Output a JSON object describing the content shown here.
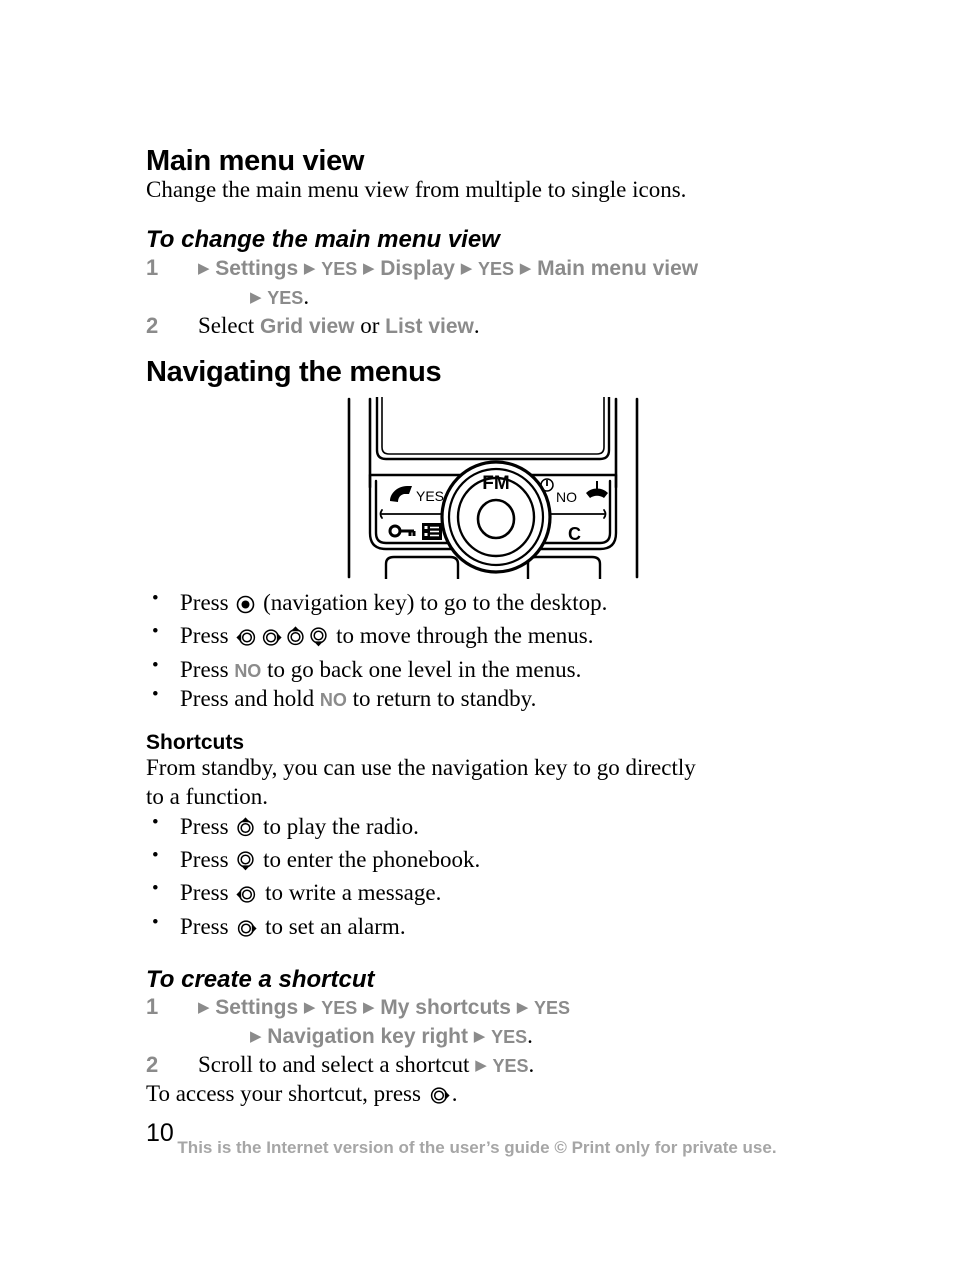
{
  "document": {
    "page_number": "10",
    "footer": "This is the Internet version of the user’s guide © Print only for private use."
  },
  "sections": {
    "main_menu_view": {
      "heading": "Main menu view",
      "intro": "Change the main menu view from multiple to single icons.",
      "procedure": {
        "heading": "To change the main menu view",
        "steps": [
          {
            "number": "1",
            "line1_parts": [
              "Settings",
              "YES",
              "Display",
              "YES",
              "Main menu view"
            ],
            "line2_part": "YES",
            "line2_suffix": "."
          },
          {
            "number": "2",
            "prefix": "Select ",
            "option_a": "Grid view",
            "conjunction": " or ",
            "option_b": "List view",
            "suffix": "."
          }
        ]
      }
    },
    "navigating": {
      "heading": "Navigating the menus",
      "figure_caption": "phone keypad and navigation key illustration",
      "bullets": [
        {
          "prefix": "Press ",
          "icon": "nav-key-center-icon",
          "suffix": " (navigation key) to go to the desktop."
        },
        {
          "prefix": "Press ",
          "icons": [
            "nav-key-left-icon",
            "nav-key-right-icon",
            "nav-key-up-icon",
            "nav-key-down-icon"
          ],
          "suffix": " to move through the menus."
        },
        {
          "prefix": "Press ",
          "ui_key": "NO",
          "suffix": " to go back one level in the menus."
        },
        {
          "prefix": "Press and hold ",
          "ui_key": "NO",
          "suffix": " to return to standby."
        }
      ]
    },
    "shortcuts": {
      "heading": "Shortcuts",
      "intro_line1": "From standby, you can use the navigation key to go directly",
      "intro_line2": "to a function.",
      "bullets": [
        {
          "prefix": "Press ",
          "icon": "nav-key-up-icon",
          "suffix": " to play the radio."
        },
        {
          "prefix": "Press ",
          "icon": "nav-key-down-icon",
          "suffix": " to enter the phonebook."
        },
        {
          "prefix": "Press ",
          "icon": "nav-key-left-icon",
          "suffix": " to write a message."
        },
        {
          "prefix": "Press ",
          "icon": "nav-key-right-icon",
          "suffix": " to set an alarm."
        }
      ],
      "procedure": {
        "heading": "To create a shortcut",
        "steps": [
          {
            "number": "1",
            "line1_parts": [
              "Settings",
              "YES",
              "My shortcuts",
              "YES"
            ],
            "line2_parts": [
              "Navigation key right",
              "YES"
            ],
            "line2_suffix": "."
          },
          {
            "number": "2",
            "prefix": "Scroll to and select a shortcut ",
            "ui_key": "YES",
            "suffix": "."
          }
        ],
        "closing": {
          "prefix": "To access your shortcut, press ",
          "icon": "nav-key-right-icon",
          "suffix": "."
        }
      }
    }
  },
  "phone_illustration": {
    "labels": {
      "fm": "FM",
      "yes": "YES",
      "no": "NO",
      "clear": "C"
    },
    "icons": [
      "call-handset-icon",
      "end-call-handset-icon",
      "power-icon",
      "key-lock-icon",
      "menu-list-icon"
    ]
  },
  "colors": {
    "ui_label_grey": "#8b8b8b",
    "footer_grey": "#a6a6a6",
    "text_black": "#000000",
    "background": "#ffffff"
  }
}
